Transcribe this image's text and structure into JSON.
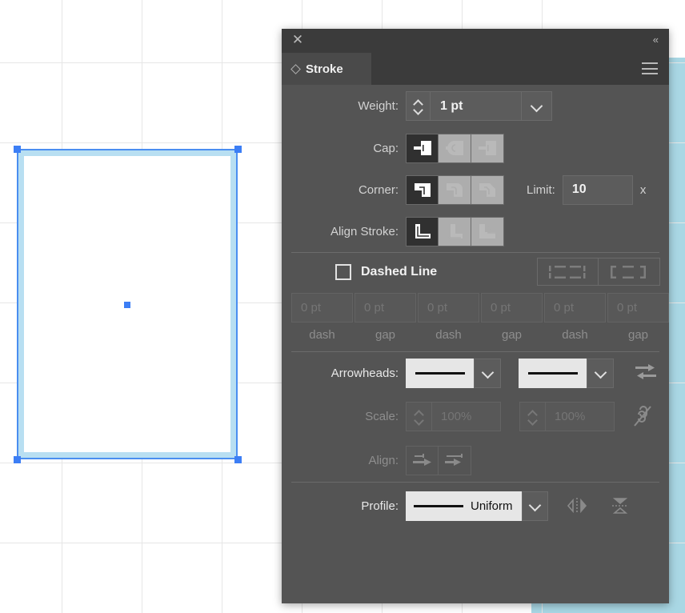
{
  "app": {
    "panel_title": "Stroke",
    "close_icon": "close-icon",
    "collapse_icon": "double-chevron-left-icon",
    "menu_icon": "hamburger-menu-icon",
    "tab_icon": "diamond-icon"
  },
  "colors": {
    "panel_bg": "#545454",
    "header_bg": "#3b3b3b",
    "tab_bg": "#4a4a4a",
    "field_bg": "#5c5c5c",
    "active_btn": "#303030",
    "idle_btn": "#adadad",
    "selection_blue": "#3c7ef5",
    "stroke_blue": "#b8dff2",
    "canvas_band": "#a9d7e4",
    "grid_line": "#e6e6e6"
  },
  "weight": {
    "label": "Weight:",
    "value": "1 pt",
    "stepper_up_icon": "chevron-up-icon",
    "stepper_down_icon": "chevron-down-icon",
    "dropdown_icon": "chevron-down-icon"
  },
  "cap": {
    "label": "Cap:",
    "options": [
      {
        "name": "butt-cap",
        "selected": true
      },
      {
        "name": "round-cap",
        "selected": false
      },
      {
        "name": "projecting-cap",
        "selected": false
      }
    ]
  },
  "corner": {
    "label": "Corner:",
    "options": [
      {
        "name": "miter-join",
        "selected": true
      },
      {
        "name": "round-join",
        "selected": false
      },
      {
        "name": "bevel-join",
        "selected": false
      }
    ],
    "limit_label": "Limit:",
    "limit_value": "10",
    "limit_unit": "x"
  },
  "align_stroke": {
    "label": "Align Stroke:",
    "options": [
      {
        "name": "align-stroke-center",
        "selected": true
      },
      {
        "name": "align-stroke-inside",
        "selected": false
      },
      {
        "name": "align-stroke-outside",
        "selected": false
      }
    ]
  },
  "dashed": {
    "label": "Dashed Line",
    "checked": false,
    "presets": [
      {
        "name": "dash-preserve-exact-lengths"
      },
      {
        "name": "dash-align-to-corners"
      }
    ],
    "fields": [
      {
        "value": "0 pt",
        "sub": "dash"
      },
      {
        "value": "0 pt",
        "sub": "gap"
      },
      {
        "value": "0 pt",
        "sub": "dash"
      },
      {
        "value": "0 pt",
        "sub": "gap"
      },
      {
        "value": "0 pt",
        "sub": "dash"
      },
      {
        "value": "0 pt",
        "sub": "gap"
      }
    ]
  },
  "arrowheads": {
    "label": "Arrowheads:",
    "start_value": "None",
    "end_value": "None",
    "swap_icon": "swap-arrows-icon"
  },
  "scale": {
    "label": "Scale:",
    "start_value": "100%",
    "end_value": "100%",
    "link_icon": "broken-chain-link-icon",
    "disabled": true
  },
  "align_arrow": {
    "label": "Align:",
    "options": [
      {
        "name": "extend-arrow-beyond-end"
      },
      {
        "name": "place-arrow-at-end"
      }
    ],
    "disabled": true
  },
  "profile": {
    "label": "Profile:",
    "value": "Uniform",
    "dropdown_icon": "chevron-down-icon",
    "flip_across_icon": "flip-profile-horizontal-icon",
    "flip_along_icon": "flip-profile-vertical-icon"
  },
  "canvas": {
    "selected_shape": "rectangle",
    "shape_stroke_color": "#b8dff2"
  }
}
